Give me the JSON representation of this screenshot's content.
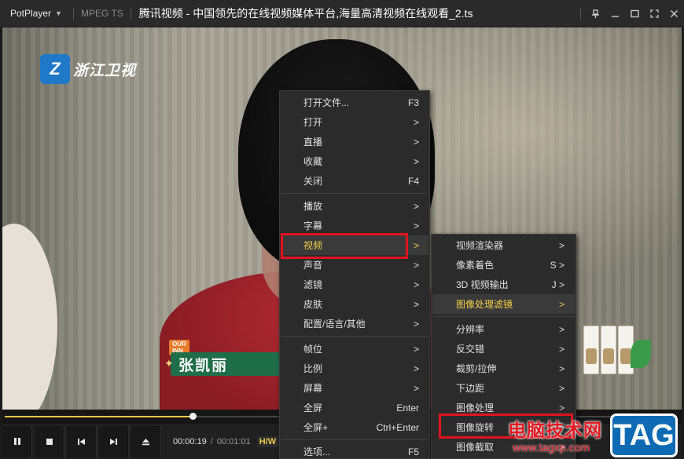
{
  "titlebar": {
    "brand": "PotPlayer",
    "format": "MPEG TS",
    "title": "腾讯视频 - 中国领先的在线视频媒体平台,海量高清视频在线观看_2.ts",
    "icons": [
      "pin-icon",
      "minimize-icon",
      "maximize-icon",
      "fullscreen-icon",
      "close-icon"
    ]
  },
  "video": {
    "channel_logo": "浙江卫视",
    "name_tag": "OUR INN",
    "name": "张凯丽"
  },
  "playback": {
    "progress": 0.28,
    "current_time": "00:00:19",
    "separator": "/",
    "duration": "00:01:01",
    "hw": "H/W"
  },
  "menu1": {
    "items": [
      {
        "label": "打开文件...",
        "shortcut": "F3"
      },
      {
        "label": "打开",
        "shortcut": ">"
      },
      {
        "label": "直播",
        "shortcut": ">"
      },
      {
        "label": "收藏",
        "shortcut": ">"
      },
      {
        "label": "关闭",
        "shortcut": "F4"
      },
      {
        "label": "播放",
        "shortcut": ">"
      },
      {
        "label": "字幕",
        "shortcut": ">"
      },
      {
        "label": "视频",
        "shortcut": ">"
      },
      {
        "label": "声音",
        "shortcut": ">"
      },
      {
        "label": "滤镜",
        "shortcut": ">"
      },
      {
        "label": "皮肤",
        "shortcut": ">"
      },
      {
        "label": "配置/语言/其他",
        "shortcut": ">"
      },
      {
        "label": "帧位",
        "shortcut": ">"
      },
      {
        "label": "比例",
        "shortcut": ">"
      },
      {
        "label": "屏幕",
        "shortcut": ">"
      },
      {
        "label": "全屏",
        "shortcut": "Enter"
      },
      {
        "label": "全屏+",
        "shortcut": "Ctrl+Enter"
      },
      {
        "label": "选项...",
        "shortcut": "F5"
      }
    ]
  },
  "menu2": {
    "items": [
      {
        "label": "视频渲染器",
        "shortcut": ">"
      },
      {
        "label": "像素着色",
        "shortcut": "S >"
      },
      {
        "label": "3D 视频输出",
        "shortcut": "J >"
      },
      {
        "label": "图像处理滤镜",
        "shortcut": ">"
      },
      {
        "label": "分辨率",
        "shortcut": ">"
      },
      {
        "label": "反交错",
        "shortcut": ">"
      },
      {
        "label": "裁剪/拉伸",
        "shortcut": ">"
      },
      {
        "label": "下边距",
        "shortcut": ">"
      },
      {
        "label": "图像处理",
        "shortcut": ">"
      },
      {
        "label": "图像旋转",
        "shortcut": ">"
      },
      {
        "label": "图像截取",
        "shortcut": ">"
      }
    ]
  },
  "watermark": {
    "text": "电脑技术网",
    "url": "www.tagxp.com",
    "badge": "TAG"
  },
  "colors": {
    "accent": "#f3d04a",
    "highlight_box": "#e0141e",
    "menu_bg": "#2b2b2b"
  }
}
